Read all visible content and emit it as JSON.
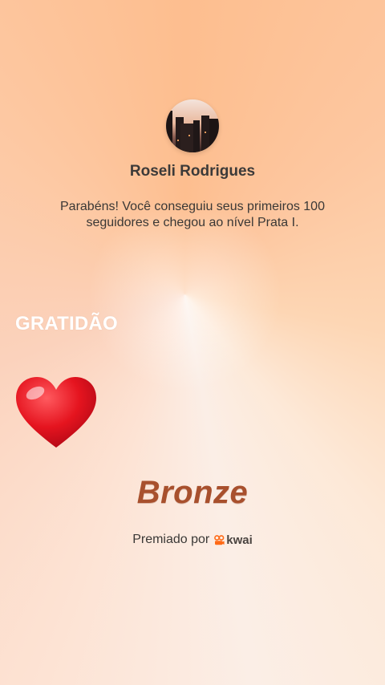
{
  "user": {
    "name": "Roseli Rodrigues",
    "avatar": "user-photo-sunset-avatar"
  },
  "message": "Parabéns! Você conseguiu seus primeiros 100 seguidores e chegou ao nível Prata I.",
  "overlay_text": "GRATIDÃO",
  "sticker": "red-heart-icon",
  "badge": {
    "level": "Bronze",
    "awarded_by_label": "Premiado por",
    "brand": "kwai"
  },
  "colors": {
    "level_text": "#a8502d",
    "brand_orange": "#ff6a16",
    "heart_red": "#e0122a"
  }
}
